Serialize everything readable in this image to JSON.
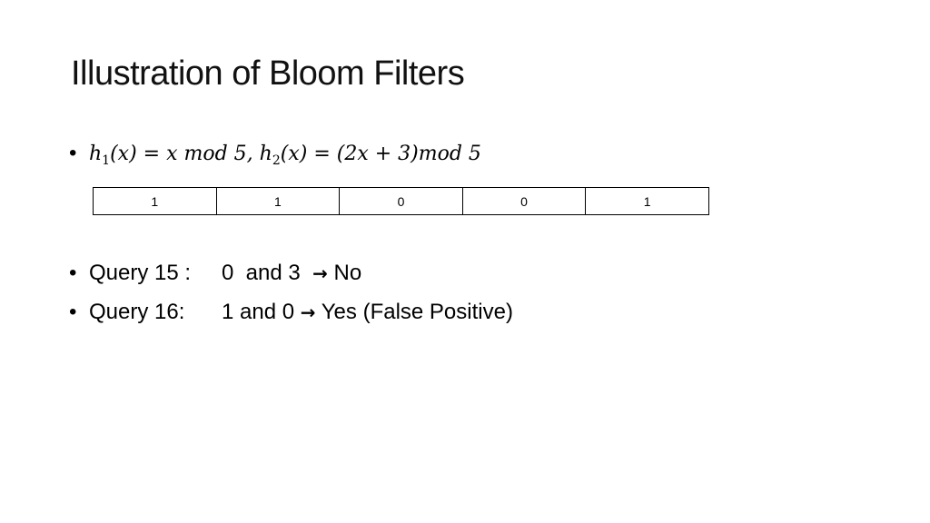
{
  "slide": {
    "title": "Illustration of Bloom Filters",
    "bullet_char": "•",
    "formula": {
      "h1_name": "h",
      "h1_sub": "1",
      "h1_rest": "(x) = x mod 5,",
      "h2_name": "h",
      "h2_sub": "2",
      "h2_rest": "(x) = (2x + 3)mod 5"
    },
    "bit_array": [
      "1",
      "1",
      "0",
      "0",
      "1"
    ],
    "queries": [
      {
        "label": "Query 15 :",
        "positions": "0  and 3",
        "arrow": "→",
        "result": "No"
      },
      {
        "label": "Query 16:",
        "positions": "1 and 0",
        "arrow": "→",
        "result": "Yes (False Positive)"
      }
    ]
  }
}
